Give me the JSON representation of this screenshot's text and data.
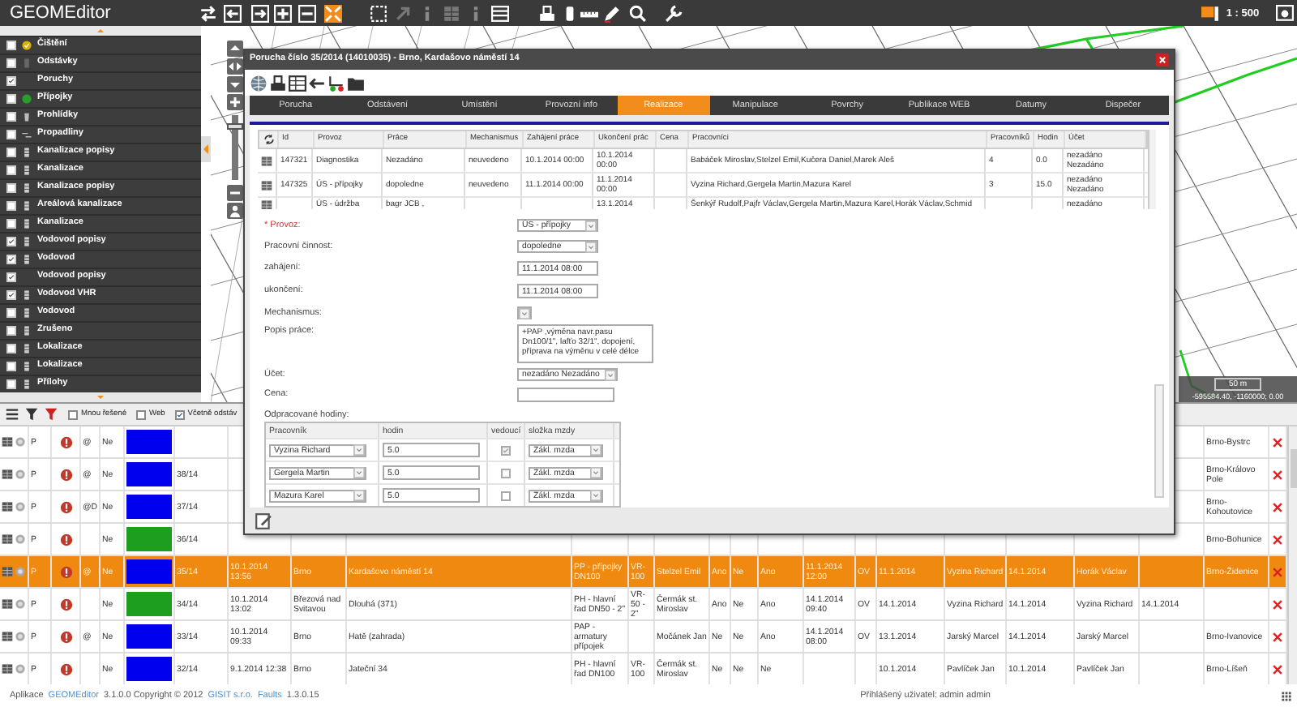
{
  "app": {
    "title": "GEOMEditor",
    "scale": "1 : 500"
  },
  "layers": [
    {
      "label": "Čištění",
      "checked": false,
      "kind": "badge"
    },
    {
      "label": "Odstávky",
      "checked": false,
      "kind": "bottle"
    },
    {
      "label": "Poruchy",
      "checked": true,
      "kind": "none"
    },
    {
      "label": "Přípojky",
      "checked": false,
      "kind": "pin"
    },
    {
      "label": "Prohlídky",
      "checked": false,
      "kind": "bin"
    },
    {
      "label": "Propadliny",
      "checked": false,
      "kind": "line"
    },
    {
      "label": "Kanalizace popisy",
      "checked": false,
      "kind": "db"
    },
    {
      "label": "Kanalizace",
      "checked": false,
      "kind": "db"
    },
    {
      "label": "Kanalizace popisy",
      "checked": false,
      "kind": "db"
    },
    {
      "label": "Areálová kanalizace",
      "checked": false,
      "kind": "db"
    },
    {
      "label": "Kanalizace",
      "checked": false,
      "kind": "db"
    },
    {
      "label": "Vodovod popisy",
      "checked": true,
      "kind": "db"
    },
    {
      "label": "Vodovod",
      "checked": true,
      "kind": "db"
    },
    {
      "label": "Vodovod popisy",
      "checked": true,
      "kind": "none"
    },
    {
      "label": "Vodovod VHR",
      "checked": true,
      "kind": "db"
    },
    {
      "label": "Vodovod",
      "checked": false,
      "kind": "db"
    },
    {
      "label": "Zrušeno",
      "checked": false,
      "kind": "db"
    },
    {
      "label": "Lokalizace",
      "checked": false,
      "kind": "db"
    },
    {
      "label": "Lokalizace",
      "checked": false,
      "kind": "db"
    },
    {
      "label": "Přílohy",
      "checked": false,
      "kind": "db"
    }
  ],
  "map": {
    "zoom": {
      "level": 0.85
    },
    "scale": "50 m",
    "coordinates": "-595584.40, -1160000; 0.00"
  },
  "grid": {
    "filters": [
      {
        "label": "Mnou řešené",
        "checked": false
      },
      {
        "label": "Web",
        "checked": false
      },
      {
        "label": "Včetně odstáv",
        "checked": true
      }
    ],
    "rows": [
      {
        "selected": false,
        "color": "#0000ee",
        "column_2": "P",
        "column_4": "@",
        "column_5": "Ne",
        "column_24": "Brno-Bystrc"
      },
      {
        "selected": false,
        "color": "#0000ee",
        "column_2": "P",
        "column_4": "@",
        "column_5": "Ne",
        "column_7": "38/14",
        "column_24": "Brno-Královo Pole"
      },
      {
        "selected": false,
        "color": "#0000ee",
        "column_2": "P",
        "column_4": "@D",
        "column_5": "Ne",
        "column_7": "37/14",
        "column_24": "Brno-Kohoutovice"
      },
      {
        "selected": false,
        "color": "#1e9e1e",
        "column_2": "P",
        "column_5": "Ne",
        "column_7": "36/14",
        "column_24": "Brno-Bohunice"
      },
      {
        "selected": true,
        "color": "#0000ee",
        "column_2": "P",
        "column_4": "@",
        "column_5": "Ne",
        "column_7": "35/14",
        "column_8": "10.1.2014 13:56",
        "column_9": "Brno",
        "column_10": "Kardašovo náměstí 14",
        "column_11": "PP - přípojky DN100",
        "column_12": "VR-100",
        "column_13": "Stelzel Emil",
        "column_14": "Ano",
        "column_15": "Ne",
        "column_16": "Ano",
        "column_17": "11.1.2014 12:00",
        "column_18": "OV",
        "column_19": "11.1.2014",
        "column_20": "Vyzina Richard",
        "column_21": "14.1.2014",
        "column_22": "Horák Václav",
        "column_24": "Brno-Židenice"
      },
      {
        "selected": false,
        "color": "#1e9e1e",
        "column_2": "P",
        "column_5": "Ne",
        "column_7": "34/14",
        "column_8": "10.1.2014 13:02",
        "column_9": "Březová nad Svitavou",
        "column_10": "Dlouhá (371)",
        "column_11": "PH - hlavní řad DN50 - 2\"",
        "column_12": "VR-50 - 2\"",
        "column_13": "Čermák st. Miroslav",
        "column_14": "Ano",
        "column_15": "Ne",
        "column_16": "Ano",
        "column_17": "14.1.2014 09:40",
        "column_18": "OV",
        "column_19": "14.1.2014",
        "column_20": "Vyzina Richard",
        "column_21": "14.1.2014",
        "column_22": "Vyzina Richard",
        "column_23": "14.1.2014"
      },
      {
        "selected": false,
        "color": "#0000ee",
        "column_2": "P",
        "column_4": "@",
        "column_5": "Ne",
        "column_7": "33/14",
        "column_8": "10.1.2014 09:33",
        "column_9": "Brno",
        "column_10": "Hatě (zahrada)",
        "column_11": "PAP - armatury přípojek",
        "column_13": "Močánek Jan",
        "column_14": "Ne",
        "column_15": "Ne",
        "column_16": "Ano",
        "column_17": "14.1.2014 08:00",
        "column_18": "OV",
        "column_19": "13.1.2014",
        "column_20": "Jarský Marcel",
        "column_21": "14.1.2014",
        "column_22": "Jarský Marcel",
        "column_24": "Brno-Ivanovice"
      },
      {
        "selected": false,
        "color": "#0000ee",
        "column_2": "P",
        "column_5": "Ne",
        "column_7": "32/14",
        "column_8": "9.1.2014 12:38",
        "column_9": "Brno",
        "column_10": "Jateční 34",
        "column_11": "PH - hlavní řad DN100",
        "column_12": "VR-100",
        "column_13": "Čermák st. Miroslav",
        "column_14": "Ne",
        "column_15": "Ne",
        "column_16": "Ne",
        "column_19": "10.1.2014",
        "column_20": "Pavlíček Jan",
        "column_21": "10.1.2014",
        "column_22": "Pavlíček Jan",
        "column_24": "Brno-Líšeň"
      }
    ]
  },
  "dialog": {
    "title": "Porucha číslo 35/2014 (14010035) - Brno, Kardašovo náměstí 14",
    "tabs": [
      {
        "label": "Porucha",
        "selected": false
      },
      {
        "label": "Odstávení",
        "selected": false
      },
      {
        "label": "Umístění",
        "selected": false
      },
      {
        "label": "Provozní info",
        "selected": false
      },
      {
        "label": "Realizace",
        "selected": true
      },
      {
        "label": "Manipulace",
        "selected": false
      },
      {
        "label": "Povrchy",
        "selected": false
      },
      {
        "label": "Publikace WEB",
        "selected": false
      },
      {
        "label": "Datumy",
        "selected": false
      },
      {
        "label": "Dispečer",
        "selected": false
      }
    ],
    "table": {
      "columns": [
        "Id",
        "Provoz",
        "Práce",
        "Mechanismus",
        "Zahájení práce",
        "Ukončení prác",
        "Cena",
        "Pracovníci",
        "Pracovníků",
        "Hodin",
        "Účet"
      ],
      "rows": [
        {
          "id": "147321",
          "provoz": "Diagnostika",
          "prace": "Nezadáno",
          "mechanismus": "neuvedeno",
          "zahajeni": "10.1.2014 00:00",
          "ukonceni": "10.1.2014 00:00",
          "pracovnici": "Babáček Miroslav,Stelzel Emil,Kučera Daniel,Marek Aleš",
          "pocet": "4",
          "hodin": "0.0",
          "ucet": "nezadáno Nezadáno"
        },
        {
          "id": "147325",
          "provoz": "ÚS - přípojky",
          "prace": "dopoledne",
          "mechanismus": "neuvedeno",
          "zahajeni": "11.1.2014 00:00",
          "ukonceni": "11.1.2014 00:00",
          "pracovnici": "Vyzina Richard,Gergela Martin,Mazura Karel",
          "pocet": "3",
          "hodin": "15.0",
          "ucet": "nezadáno Nezadáno"
        },
        {
          "provoz": "ÚS - údržba",
          "prace": "bagr JCB ,",
          "ukonceni": "13.1.2014",
          "pracovnici": "Šenkýř Rudolf,Pajfr Václav,Gergela Martin,Mazura Karel,Horák Václav,Schmid",
          "ucet": "nezadáno"
        }
      ]
    },
    "fields": [
      {
        "label": "* Provoz:",
        "required": true,
        "kind": "select",
        "value": "ÚS - přípojky"
      },
      {
        "label": "Pracovní činnost:",
        "required": false,
        "kind": "select",
        "value": "dopoledne"
      },
      {
        "label": "zahájení:",
        "required": false,
        "kind": "input",
        "value": "11.1.2014 08:00"
      },
      {
        "label": "ukončení:",
        "required": false,
        "kind": "input",
        "value": "11.1.2014 08:00"
      },
      {
        "label": "Mechanismus:",
        "required": false,
        "kind": "select"
      },
      {
        "label": "Popis práce:",
        "required": false,
        "kind": "textarea",
        "value": "+PAP ,výměna navr.pasu Dn100/1\", lafťo 32/1\", dopojení, příprava na výměnu v celé délce"
      },
      {
        "label": "Účet:",
        "required": false,
        "kind": "select",
        "value": "nezadáno Nezadáno"
      },
      {
        "label": "Cena:",
        "required": false,
        "kind": "input"
      }
    ],
    "hours": {
      "label": "Odpracované hodiny:",
      "columns": [
        "Pracovník",
        "hodin",
        "vedoucí",
        "složka mzdy"
      ],
      "rows": [
        {
          "worker": "Vyzina Richard",
          "hours": "5.0",
          "checked": true,
          "wage": "Zákl. mzda"
        },
        {
          "worker": "Gergela Martin",
          "hours": "5.0",
          "checked": false,
          "wage": "Zákl. mzda"
        },
        {
          "worker": "Mazura Karel",
          "hours": "5.0",
          "checked": false,
          "wage": "Zákl. mzda"
        }
      ]
    }
  },
  "footer": {
    "parts": [
      {
        "text": "Aplikace",
        "link": false
      },
      {
        "text": "GEOMEditor",
        "link": true
      },
      {
        "text": "3.1.0.0 Copyright © 2012",
        "link": false
      },
      {
        "text": "GISIT s.r.o.",
        "link": true
      },
      {
        "text": "Faults",
        "link": true
      },
      {
        "text": "1.3.0.15",
        "link": false
      }
    ],
    "user": "Přihlášený uživatel: admin admin"
  }
}
